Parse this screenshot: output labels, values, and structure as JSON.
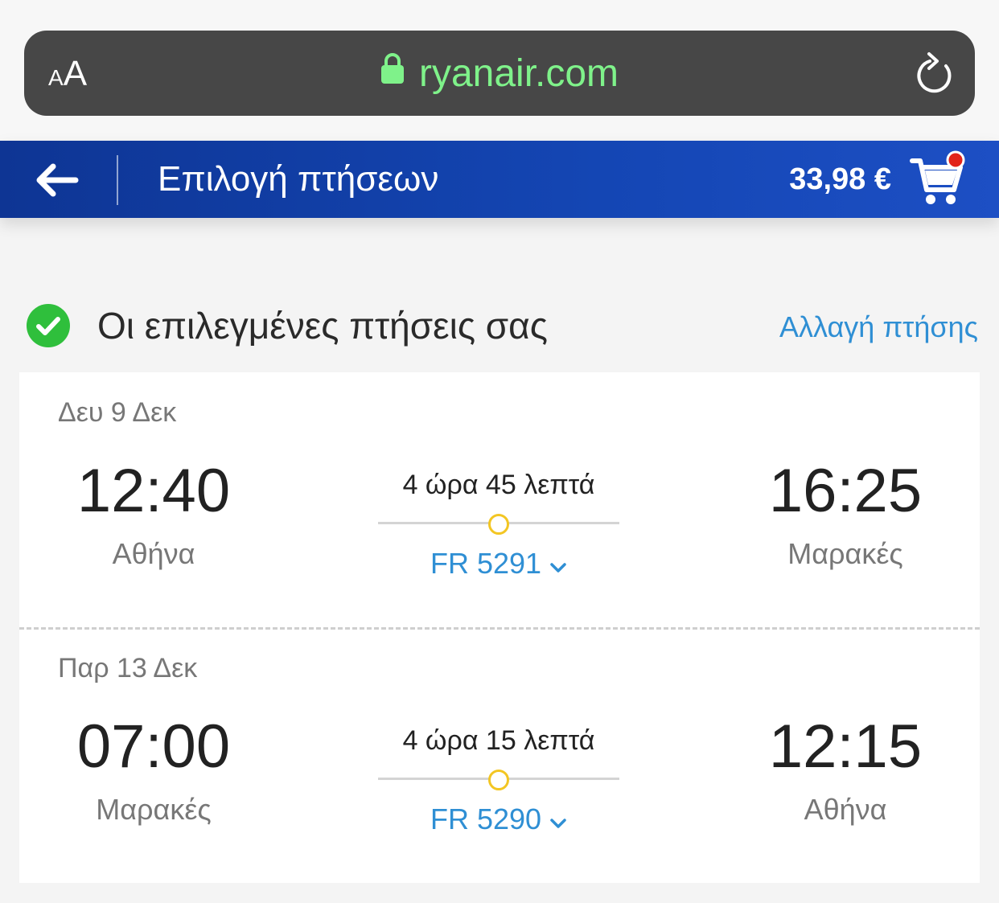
{
  "browser": {
    "text_size_small": "A",
    "text_size_big": "A",
    "domain": "ryanair.com",
    "domain_color": "#7ff28a"
  },
  "header": {
    "back_icon": "arrow-left-icon",
    "title": "Επιλογή πτήσεων",
    "total_price": "33,98 €",
    "cart_icon": "shopping-cart-icon",
    "brand_color": "#1446b4"
  },
  "section": {
    "title": "Οι επιλεγμένες πτήσεις σας",
    "change_link": "Αλλαγή πτήσης",
    "check_icon": "check-circle-icon"
  },
  "flights": [
    {
      "date": "Δευ 9 Δεκ",
      "departure_time": "12:40",
      "departure_city": "Αθήνα",
      "duration": "4 ώρα 45 λεπτά",
      "flight_number": "FR 5291",
      "arrival_time": "16:25",
      "arrival_city": "Μαρακές"
    },
    {
      "date": "Παρ 13 Δεκ",
      "departure_time": "07:00",
      "departure_city": "Μαρακές",
      "duration": "4 ώρα 15 λεπτά",
      "flight_number": "FR 5290",
      "arrival_time": "12:15",
      "arrival_city": "Αθήνα"
    }
  ]
}
